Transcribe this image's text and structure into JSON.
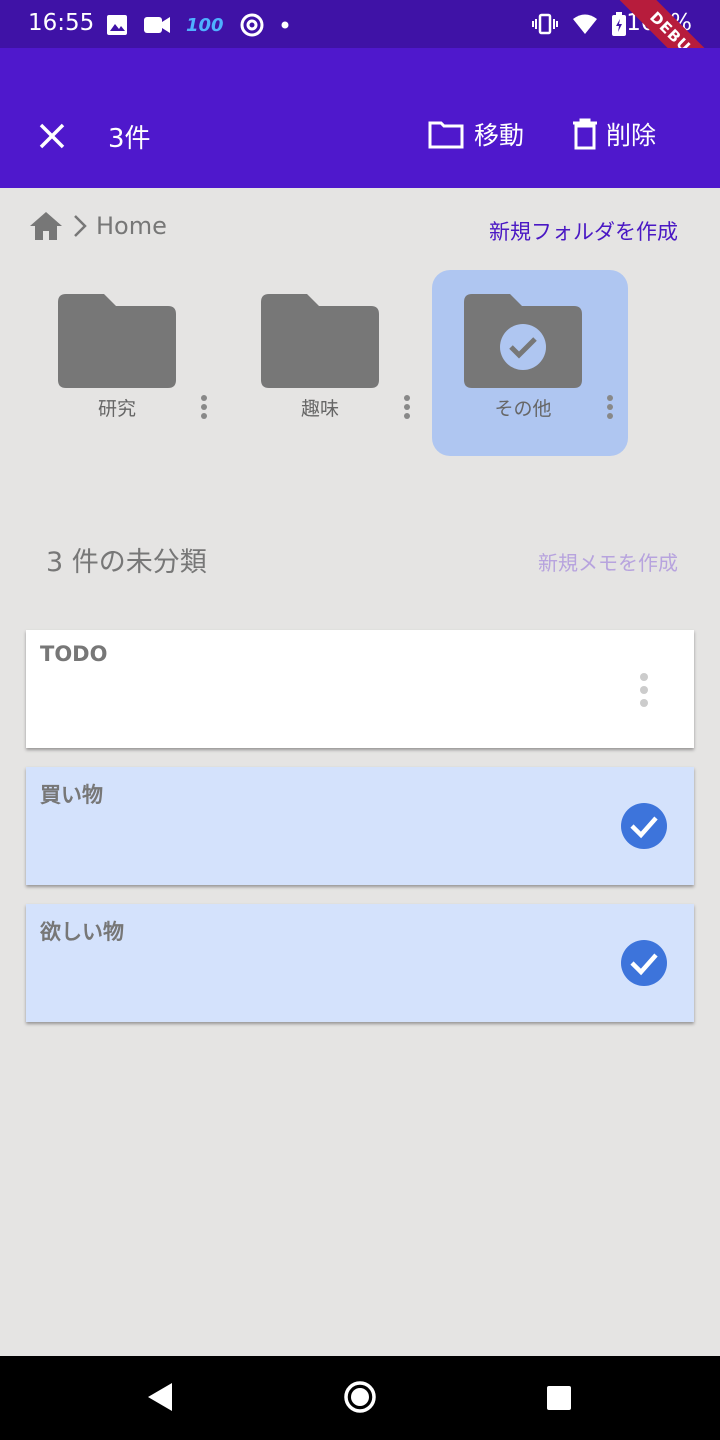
{
  "status_bar": {
    "time": "16:55",
    "indicator": "100",
    "battery": "100%",
    "debug_banner": "DEBUG"
  },
  "app_bar": {
    "selection_count": "3件",
    "move_label": "移動",
    "delete_label": "削除"
  },
  "breadcrumb": {
    "current": "Home",
    "new_folder_label": "新規フォルダを作成"
  },
  "folders": [
    {
      "name": "研究",
      "selected": false
    },
    {
      "name": "趣味",
      "selected": false
    },
    {
      "name": "その他",
      "selected": true
    }
  ],
  "uncategorized": {
    "title": "3 件の未分類",
    "new_memo_label": "新規メモを作成"
  },
  "memos": [
    {
      "title": "TODO",
      "selected": false
    },
    {
      "title": "買い物",
      "selected": true
    },
    {
      "title": "欲しい物",
      "selected": true
    }
  ],
  "colors": {
    "status_bar": "#3f12a6",
    "app_bar": "#4f18cc",
    "selected_folder": "#afc6f1",
    "selected_memo": "#d4e2fc",
    "check": "#3d74db"
  }
}
